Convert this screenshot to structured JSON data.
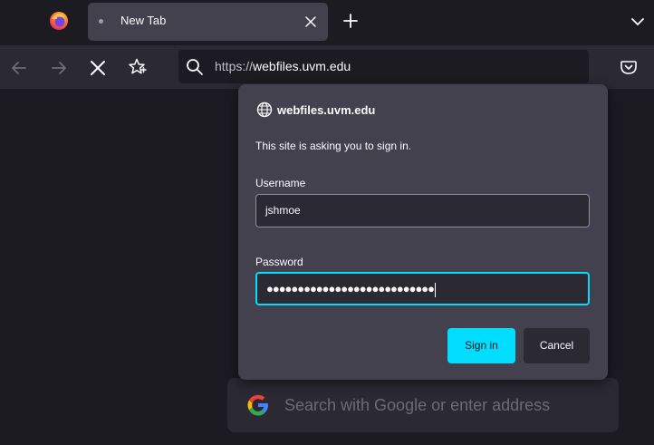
{
  "tab": {
    "title": "New Tab"
  },
  "urlbar": {
    "scheme": "https://",
    "host": "webfiles.uvm.edu"
  },
  "dialog": {
    "host": "webfiles.uvm.edu",
    "message": "This site is asking you to sign in.",
    "username_label": "Username",
    "username_value": "jshmoe",
    "password_label": "Password",
    "password_masked": "●●●●●●●●●●●●●●●●●●●●●●●●●●●",
    "signin_label": "Sign in",
    "cancel_label": "Cancel"
  },
  "newtab_search": {
    "placeholder": "Search with Google or enter address"
  },
  "colors": {
    "accent": "#00ddff",
    "dialog_bg": "#42414d",
    "toolbar_bg": "#2b2a33",
    "tabbar_bg": "#1c1b22"
  }
}
